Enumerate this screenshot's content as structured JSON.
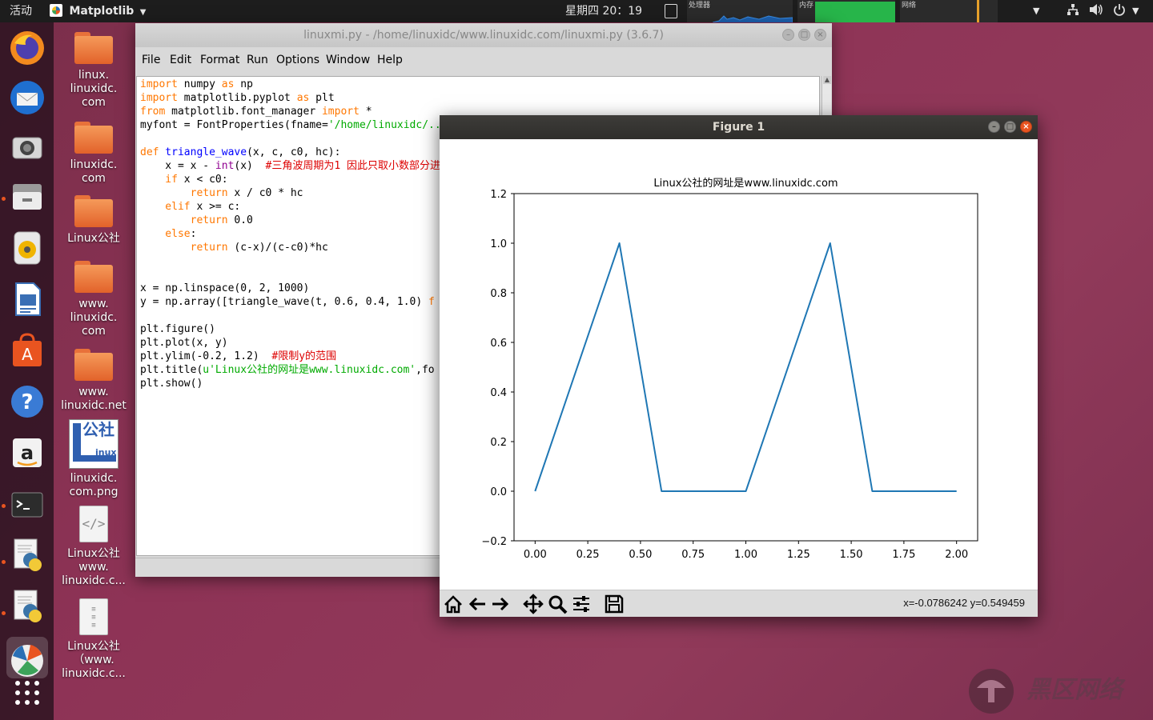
{
  "topbar": {
    "activities": "活动",
    "app_name": "Matplotlib",
    "clock": "星期四 20：19",
    "cpu_label": "处理器",
    "mem_label": "内存",
    "net_label": "网络"
  },
  "dock": {
    "items": [
      "firefox",
      "thunderbird",
      "camera",
      "files",
      "rhythmbox",
      "libreoffice-writer",
      "software-center",
      "help",
      "amazon",
      "terminal",
      "python-idle",
      "python-idle-2",
      "matplotlib",
      "app-grid"
    ]
  },
  "desktop": {
    "icons": [
      {
        "label": "linux.\nlinuxidc.\ncom",
        "type": "folder"
      },
      {
        "label": "linuxidc.\ncom",
        "type": "folder"
      },
      {
        "label": "Linux公社",
        "type": "folder"
      },
      {
        "label": "www.\nlinuxidc.\ncom",
        "type": "folder"
      },
      {
        "label": "www.\nlinuxidc.net",
        "type": "folder"
      },
      {
        "label": "linuxidc.\ncom.png",
        "type": "image"
      },
      {
        "label": "Linux公社\nwww.\nlinuxidc.c...",
        "type": "code"
      },
      {
        "label": "Linux公社\n（www.\nlinuxidc.c...",
        "type": "text"
      }
    ],
    "png_thumb_text": "公社",
    "png_thumb_sub": "inux"
  },
  "idle": {
    "title": "linuxmi.py - /home/linuxidc/www.linuxidc.com/linuxmi.py (3.6.7)",
    "menu": [
      "File",
      "Edit",
      "Format",
      "Run",
      "Options",
      "Window",
      "Help"
    ],
    "code": {
      "l1_kw": "import",
      "l1_rest": " numpy ",
      "l1_as": "as",
      "l1_end": " np",
      "l2_kw": "import",
      "l2_rest": " matplotlib.pyplot ",
      "l2_as": "as",
      "l2_end": " plt",
      "l3_kw": "from",
      "l3_rest": " matplotlib.font_manager ",
      "l3_imp": "import",
      "l3_end": " *",
      "l4_a": "myfont = FontProperties(fname=",
      "l4_str": "'/home/linuxidc/...",
      "l6_kw": "def",
      "l6_fn": " triangle_wave",
      "l6_rest": "(x, c, c0, hc):",
      "l7_a": "    x = x - ",
      "l7_bi": "int",
      "l7_b": "(x)  ",
      "l7_cm": "#三角波周期为1 因此只取小数部分进",
      "l8_kw": "    if",
      "l8_rest": " x < c0:",
      "l9_kw": "        return",
      "l9_rest": " x / c0 * hc",
      "l10_kw": "    elif",
      "l10_rest": " x >= c:",
      "l11_kw": "        return",
      "l11_rest": " 0.0",
      "l12_kw": "    else",
      "l12_rest": ":",
      "l13_kw": "        return",
      "l13_rest": " (c-x)/(c-c0)*hc",
      "l16": "x = np.linspace(0, 2, 1000)",
      "l17_a": "y = np.array([triangle_wave(t, 0.6, 0.4, 1.0) ",
      "l17_kw": "f",
      "l19": "plt.figure()",
      "l20": "plt.plot(x, y)",
      "l21_a": "plt.ylim(-0.2, 1.2)  ",
      "l21_cm": "#限制y的范围",
      "l22_a": "plt.title(",
      "l22_str": "u'Linux公社的网址是www.linuxidc.com'",
      "l22_b": ",fo",
      "l23": "plt.show()"
    }
  },
  "figure": {
    "title": "Figure 1",
    "coords": "x=-0.0786242  y=0.549459",
    "toolbar": [
      "home",
      "back",
      "forward",
      "pan",
      "zoom",
      "configure-subplots",
      "save"
    ]
  },
  "chart_data": {
    "type": "line",
    "title": "Linux公社的网址是www.linuxidc.com",
    "xlabel": "",
    "ylabel": "",
    "xlim": [
      -0.1,
      2.1
    ],
    "ylim": [
      -0.2,
      1.2
    ],
    "xticks": [
      0.0,
      0.25,
      0.5,
      0.75,
      1.0,
      1.25,
      1.5,
      1.75,
      2.0
    ],
    "xtick_labels": [
      "0.00",
      "0.25",
      "0.50",
      "0.75",
      "1.00",
      "1.25",
      "1.50",
      "1.75",
      "2.00"
    ],
    "yticks": [
      -0.2,
      0.0,
      0.2,
      0.4,
      0.6,
      0.8,
      1.0,
      1.2
    ],
    "ytick_labels": [
      "−0.2",
      "0.0",
      "0.2",
      "0.4",
      "0.6",
      "0.8",
      "1.0",
      "1.2"
    ],
    "grid": false,
    "series": [
      {
        "color": "#1f77b4",
        "x": [
          0.0,
          0.4,
          0.6,
          1.0,
          1.4,
          1.6,
          2.0
        ],
        "y": [
          0.0,
          1.0,
          0.0,
          0.0,
          1.0,
          0.0,
          0.0
        ]
      }
    ]
  },
  "watermark": {
    "text": "黑区网络"
  }
}
